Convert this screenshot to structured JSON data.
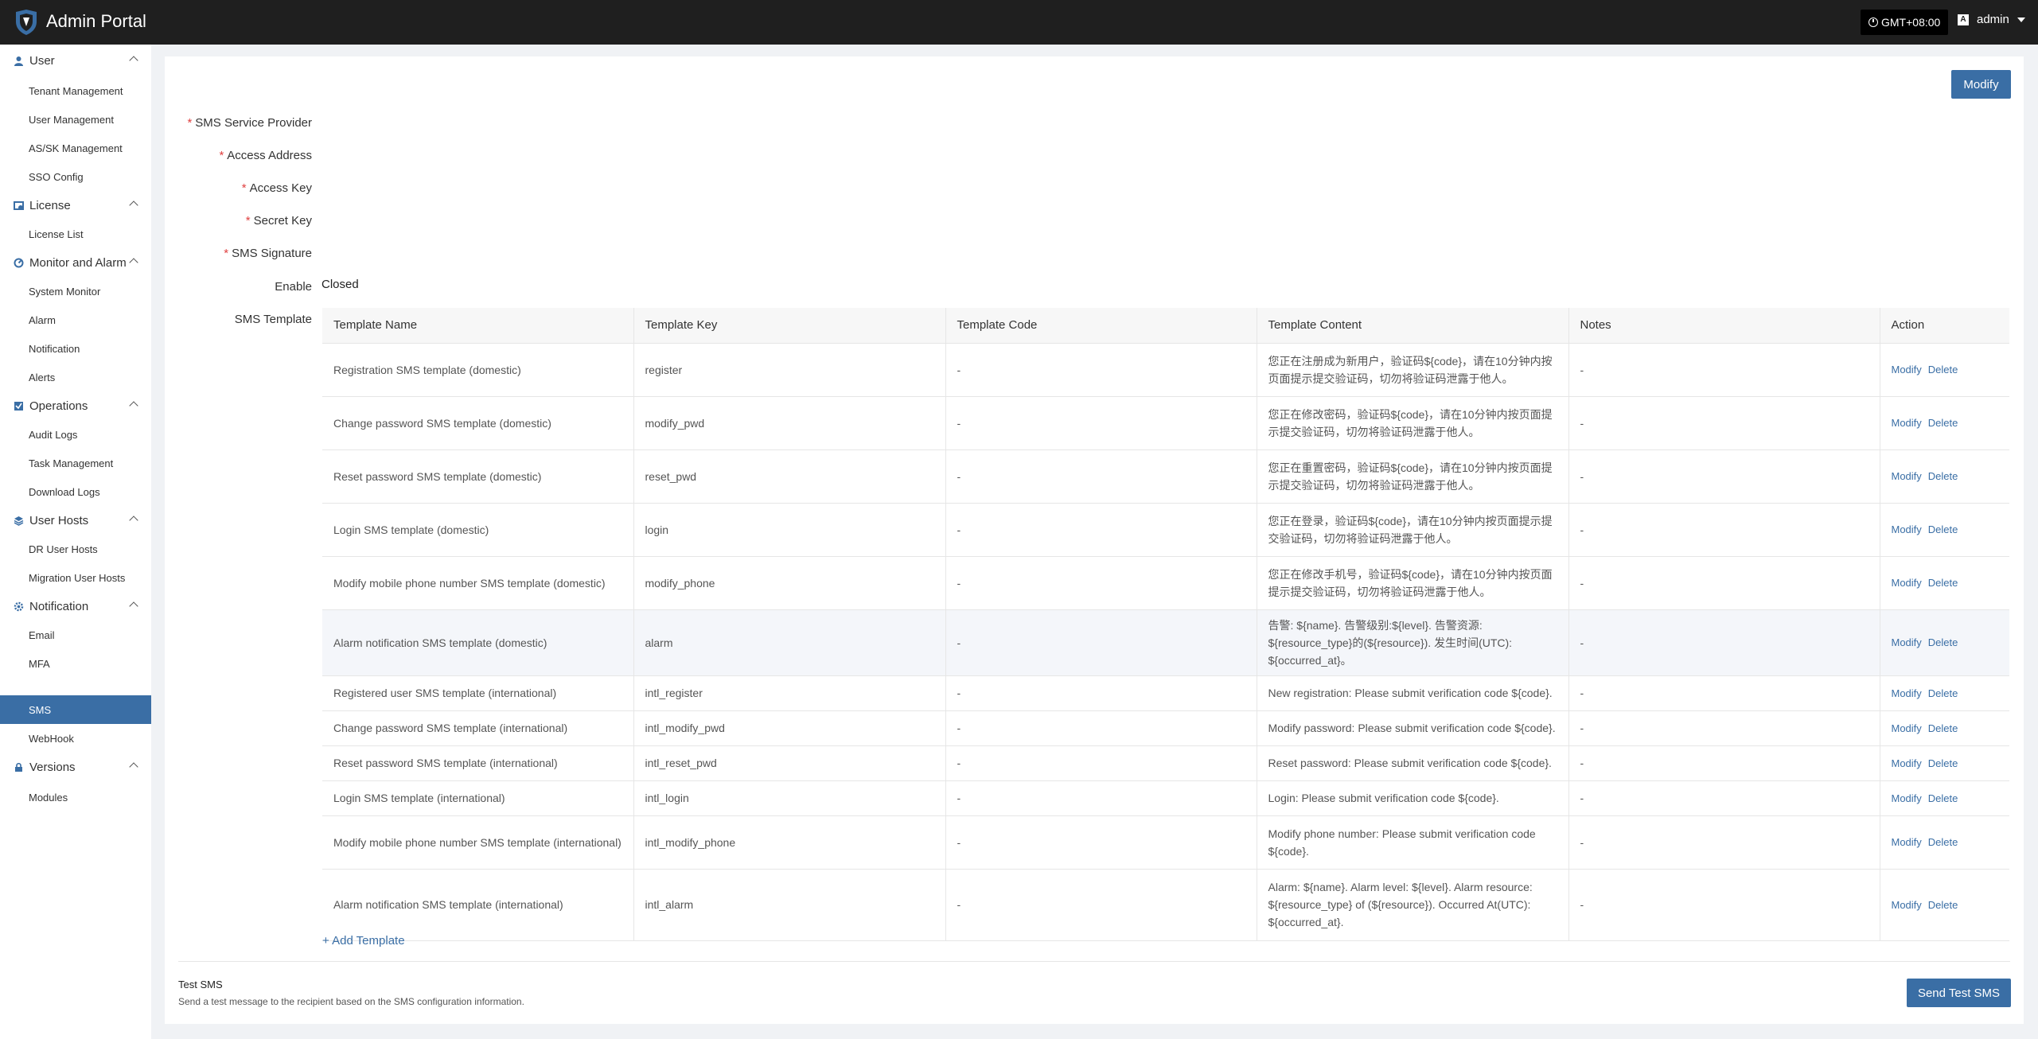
{
  "header": {
    "title": "Admin Portal",
    "timezone": "GMT+08:00",
    "username": "admin",
    "avatar_letter": "A"
  },
  "sidebar": {
    "groups": [
      {
        "label": "User",
        "icon": "user-icon",
        "items": [
          "Tenant Management",
          "User Management",
          "AS/SK Management",
          "SSO Config"
        ]
      },
      {
        "label": "License",
        "icon": "license-icon",
        "items": [
          "License List"
        ]
      },
      {
        "label": "Monitor and Alarm",
        "icon": "monitor-icon",
        "items": [
          "System Monitor",
          "Alarm",
          "Notification",
          "Alerts"
        ]
      },
      {
        "label": "Operations",
        "icon": "operations-icon",
        "items": [
          "Audit Logs",
          "Task Management",
          "Download Logs"
        ]
      },
      {
        "label": "User Hosts",
        "icon": "hosts-icon",
        "items": [
          "DR User Hosts",
          "Migration User Hosts"
        ]
      },
      {
        "label": "Notification",
        "icon": "gear-icon",
        "items": [
          "Email",
          "MFA",
          "SMS",
          "WebHook"
        ]
      },
      {
        "label": "Versions",
        "icon": "versions-icon",
        "items": [
          "Modules"
        ]
      }
    ],
    "active_item": "SMS"
  },
  "form": {
    "modify_label": "Modify",
    "fields": {
      "provider": "SMS Service Provider",
      "address": "Access Address",
      "access_key": "Access Key",
      "secret_key": "Secret Key",
      "signature": "SMS Signature",
      "enable": "Enable",
      "template": "SMS Template"
    },
    "enable_value": "Closed"
  },
  "table": {
    "columns": [
      "Template Name",
      "Template Key",
      "Template Code",
      "Template Content",
      "Notes",
      "Action"
    ],
    "action_modify": "Modify",
    "action_delete": "Delete",
    "rows": [
      {
        "name": "Registration SMS template (domestic)",
        "key": "register",
        "code": "-",
        "content": "您正在注册成为新用户，验证码${code}，请在10分钟内按页面提示提交验证码，切勿将验证码泄露于他人。",
        "notes": "-"
      },
      {
        "name": "Change password SMS template (domestic)",
        "key": "modify_pwd",
        "code": "-",
        "content": "您正在修改密码，验证码${code}，请在10分钟内按页面提示提交验证码，切勿将验证码泄露于他人。",
        "notes": "-"
      },
      {
        "name": "Reset password SMS template (domestic)",
        "key": "reset_pwd",
        "code": "-",
        "content": "您正在重置密码，验证码${code}，请在10分钟内按页面提示提交验证码，切勿将验证码泄露于他人。",
        "notes": "-"
      },
      {
        "name": "Login SMS template (domestic)",
        "key": "login",
        "code": "-",
        "content": "您正在登录，验证码${code}，请在10分钟内按页面提示提交验证码，切勿将验证码泄露于他人。",
        "notes": "-"
      },
      {
        "name": "Modify mobile phone number SMS template (domestic)",
        "key": "modify_phone",
        "code": "-",
        "content": "您正在修改手机号，验证码${code}，请在10分钟内按页面提示提交验证码，切勿将验证码泄露于他人。",
        "notes": "-"
      },
      {
        "name": "Alarm notification SMS template (domestic)",
        "key": "alarm",
        "code": "-",
        "content": "告警: ${name}. 告警级别:${level}. 告警资源: ${resource_type}的(${resource}). 发生时间(UTC): ${occurred_at}。",
        "notes": "-"
      },
      {
        "name": "Registered user SMS template (international)",
        "key": "intl_register",
        "code": "-",
        "content": "New registration: Please submit verification code ${code}.",
        "notes": "-"
      },
      {
        "name": "Change password SMS template (international)",
        "key": "intl_modify_pwd",
        "code": "-",
        "content": "Modify password: Please submit verification code ${code}.",
        "notes": "-"
      },
      {
        "name": "Reset password SMS template (international)",
        "key": "intl_reset_pwd",
        "code": "-",
        "content": "Reset password: Please submit verification code ${code}.",
        "notes": "-"
      },
      {
        "name": "Login SMS template (international)",
        "key": "intl_login",
        "code": "-",
        "content": "Login: Please submit verification code ${code}.",
        "notes": "-"
      },
      {
        "name": "Modify mobile phone number SMS template (international)",
        "key": "intl_modify_phone",
        "code": "-",
        "content": "Modify phone number: Please submit verification code ${code}.",
        "notes": "-"
      },
      {
        "name": "Alarm notification SMS template (international)",
        "key": "intl_alarm",
        "code": "-",
        "content": "Alarm: ${name}. Alarm level: ${level}. Alarm resource: ${resource_type} of (${resource}). Occurred At(UTC): ${occurred_at}.",
        "notes": "-"
      }
    ]
  },
  "add_template_label": "+ Add Template",
  "test_sms": {
    "title": "Test SMS",
    "description": "Send a test message to the recipient based on the SMS configuration information.",
    "button_label": "Send Test SMS"
  }
}
